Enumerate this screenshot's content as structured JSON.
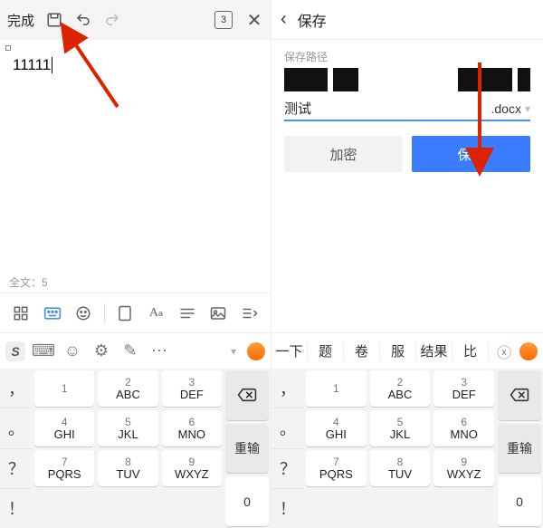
{
  "left": {
    "done_label": "完成",
    "page_indicator": "3",
    "document_text": "11111",
    "word_count_label": "全文：5",
    "keypad": {
      "rows": [
        [
          "1",
          "2 ABC",
          "3 DEF"
        ],
        [
          "4 GHI",
          "5 JKL",
          "6 MNO"
        ],
        [
          "7 PQRS",
          "8 TUV",
          "9 WXYZ"
        ]
      ],
      "zero": "0",
      "symbols_left": [
        "，",
        "。",
        "？",
        "！"
      ],
      "right_buttons": [
        "⌫",
        "重输",
        "0"
      ],
      "suggest_icons": [
        "S",
        "⌨",
        "☺",
        "⚙",
        "✎",
        "⋯"
      ]
    }
  },
  "right": {
    "title": "保存",
    "section_label": "保存路径",
    "filename_value": "测试",
    "extension": ".docx",
    "encrypt_label": "加密",
    "save_label": "保存",
    "predictions": [
      "一下",
      "题",
      "卷",
      "服",
      "结果",
      "比"
    ],
    "keypad": {
      "rows": [
        [
          "1",
          "2 ABC",
          "3 DEF"
        ],
        [
          "4 GHI",
          "5 JKL",
          "6 MNO"
        ],
        [
          "7 PQRS",
          "8 TUV",
          "9 WXYZ"
        ]
      ],
      "zero": "0",
      "symbols_left": [
        "，",
        "。",
        "？",
        "！"
      ],
      "right_buttons": [
        "⌫",
        "重输",
        "0"
      ]
    }
  }
}
